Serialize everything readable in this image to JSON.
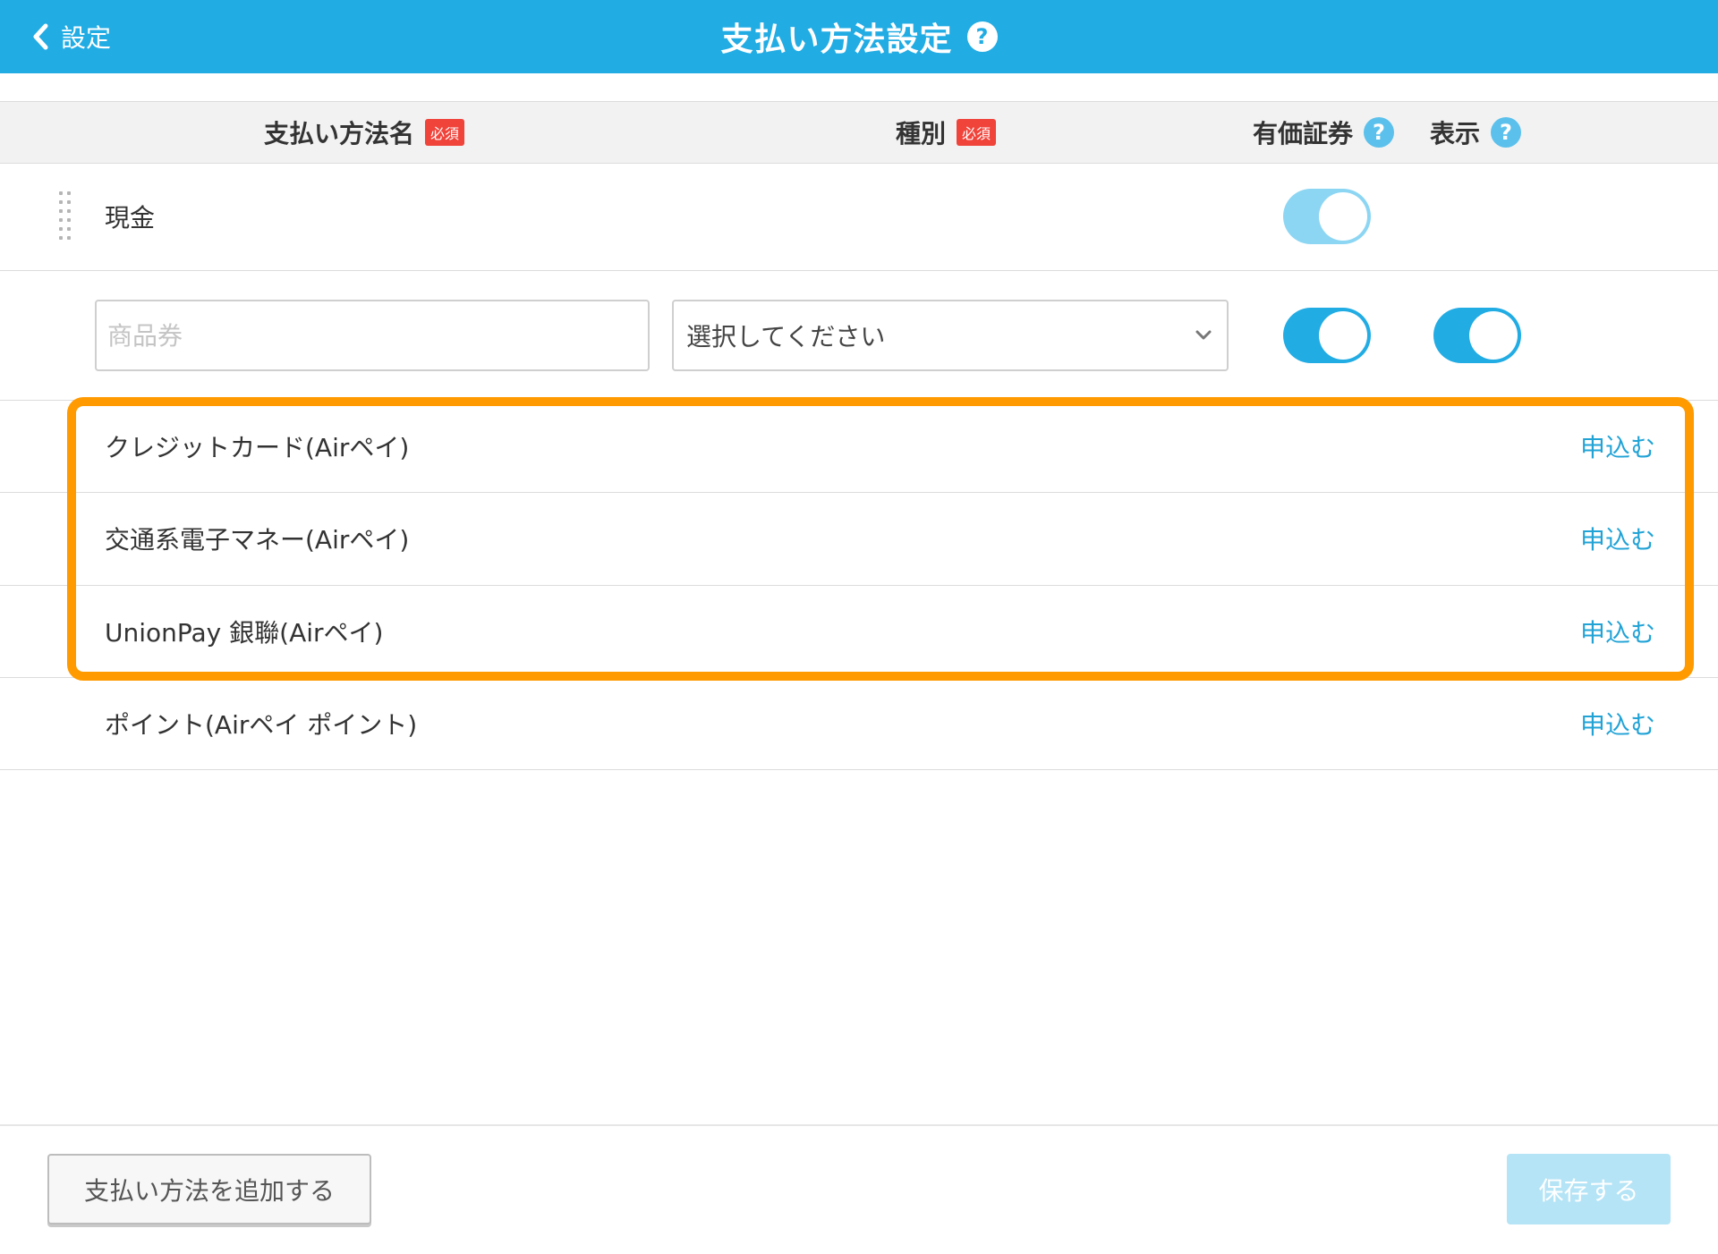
{
  "header": {
    "back_label": "設定",
    "title": "支払い方法設定",
    "help": "?"
  },
  "columns": {
    "name": "支払い方法名",
    "name_badge": "必須",
    "type": "種別",
    "type_badge": "必須",
    "voucher": "有価証券",
    "voucher_help": "?",
    "display": "表示",
    "display_help": "?"
  },
  "rows": {
    "cash": {
      "label": "現金",
      "voucher_toggle": "on"
    },
    "new_entry": {
      "name_value": "",
      "name_placeholder": "商品券",
      "type_selected": "選択してください",
      "voucher_toggle": "on",
      "display_toggle": "on"
    },
    "items": [
      {
        "label": "クレジットカード(Airペイ)",
        "action": "申込む"
      },
      {
        "label": "交通系電子マネー(Airペイ)",
        "action": "申込む"
      },
      {
        "label": "UnionPay 銀聯(Airペイ)",
        "action": "申込む"
      },
      {
        "label": "ポイント(Airペイ ポイント)",
        "action": "申込む"
      }
    ]
  },
  "footer": {
    "add_label": "支払い方法を追加する",
    "save_label": "保存する"
  },
  "colors": {
    "header": "#22ace4",
    "accent_link": "#22a3d6",
    "required_badge": "#f0433a",
    "highlight": "#ff9a00",
    "toggle_on": "#22ace4",
    "toggle_disabled": "#8dd6f3",
    "save_disabled": "#b5e4f6"
  },
  "icons": {
    "back": "chevron-left-icon",
    "help": "question-icon",
    "select": "chevron-down-icon",
    "drag": "drag-handle-icon"
  }
}
